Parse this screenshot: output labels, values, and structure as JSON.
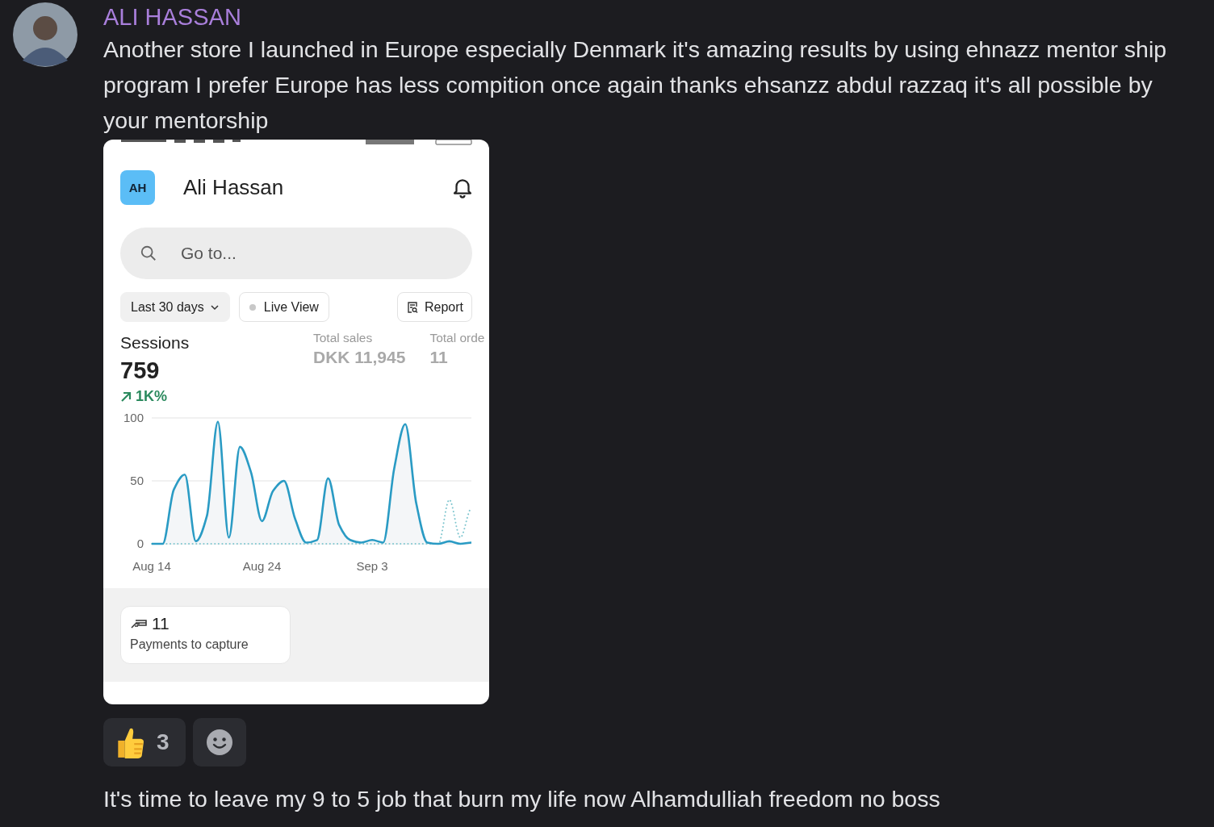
{
  "message": {
    "author": "ALI HASSAN",
    "text": "Another store I launched in Europe especially Denmark it's amazing results by using ehnazz mentor ship program I prefer Europe has less compition once again thanks ehsanzz abdul razzaq it's all possible by your mentorship",
    "attachment": {
      "header": {
        "initials": "AH",
        "title": "Ali Hassan"
      },
      "search": {
        "placeholder": "Go to..."
      },
      "filters": [
        {
          "kind": "dropdown",
          "label": "Last 30 days"
        },
        {
          "kind": "live",
          "label": "Live View"
        },
        {
          "kind": "report",
          "label": "Report"
        }
      ],
      "sessions": {
        "label": "Sessions",
        "value": "759",
        "change": "1K%"
      },
      "metrics": [
        {
          "label": "Total sales",
          "value": "DKK 11,945"
        },
        {
          "label": "Total orde",
          "value": "11"
        }
      ],
      "chart_data": {
        "type": "line",
        "categories": [
          "Aug 14",
          null,
          null,
          null,
          null,
          null,
          null,
          null,
          null,
          null,
          "Aug 24",
          null,
          null,
          null,
          null,
          null,
          null,
          null,
          null,
          null,
          "Sep 3",
          null,
          null,
          null,
          null,
          null,
          null,
          null,
          null,
          null
        ],
        "ylim": [
          0,
          100
        ],
        "yticks": [
          0,
          50,
          100
        ],
        "series": [
          {
            "color": "#2a9bc4",
            "line_style": "solid",
            "values": [
              0,
              0,
              43,
              55,
              2,
              22,
              97,
              5,
              77,
              57,
              18,
              42,
              50,
              20,
              1,
              3,
              52,
              15,
              3,
              1,
              3,
              1,
              60,
              95,
              32,
              1,
              0,
              2,
              0,
              1
            ]
          },
          {
            "color": "#7fc6cf",
            "line_style": "dotted",
            "values": [
              0,
              0,
              0,
              0,
              0,
              0,
              0,
              0,
              0,
              0,
              0,
              0,
              0,
              0,
              0,
              0,
              0,
              0,
              0,
              0,
              0,
              0,
              0,
              0,
              0,
              0,
              0,
              35,
              5,
              28
            ]
          }
        ]
      },
      "payments": {
        "count": "11",
        "label": "Payments to capture"
      }
    },
    "reactions": [
      {
        "kind": "thumbs-up",
        "count": "3"
      },
      {
        "kind": "add"
      }
    ]
  },
  "next_message": {
    "text": "It's time to leave my 9 to 5 job that burn my life now Alhamdulliah freedom no boss"
  }
}
